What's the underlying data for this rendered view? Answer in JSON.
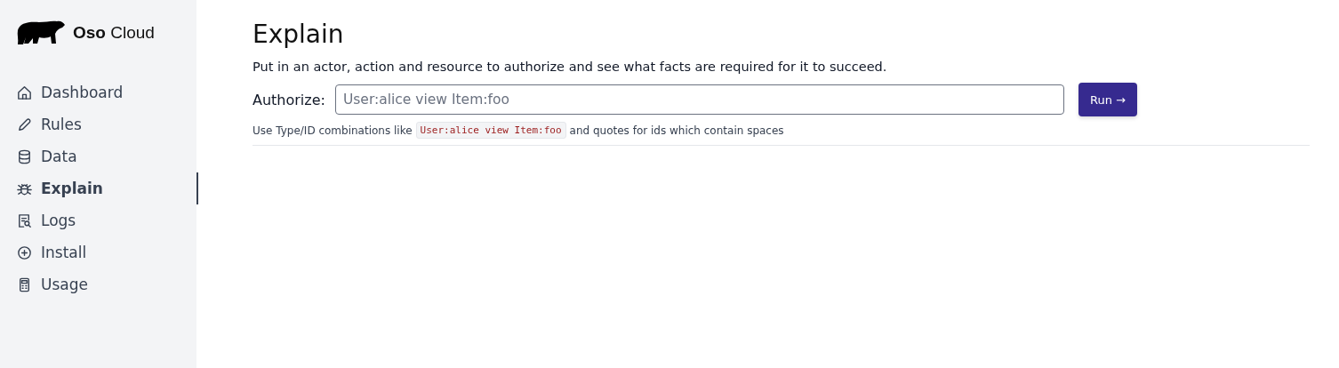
{
  "brand": {
    "name_bold": "Oso",
    "name_rest": "Cloud"
  },
  "sidebar": {
    "items": [
      {
        "label": "Dashboard",
        "selected": false
      },
      {
        "label": "Rules",
        "selected": false
      },
      {
        "label": "Data",
        "selected": false
      },
      {
        "label": "Explain",
        "selected": true
      },
      {
        "label": "Logs",
        "selected": false
      },
      {
        "label": "Install",
        "selected": false
      },
      {
        "label": "Usage",
        "selected": false
      }
    ]
  },
  "page": {
    "title": "Explain",
    "description": "Put in an actor, action and resource to authorize and see what facts are required for it to succeed.",
    "field_label": "Authorize:",
    "placeholder": "User:alice view Item:foo",
    "button": "Run →",
    "hint_before": "Use Type/ID combinations like",
    "hint_code": "User:alice view Item:foo",
    "hint_after": "and quotes for ids which contain spaces"
  }
}
